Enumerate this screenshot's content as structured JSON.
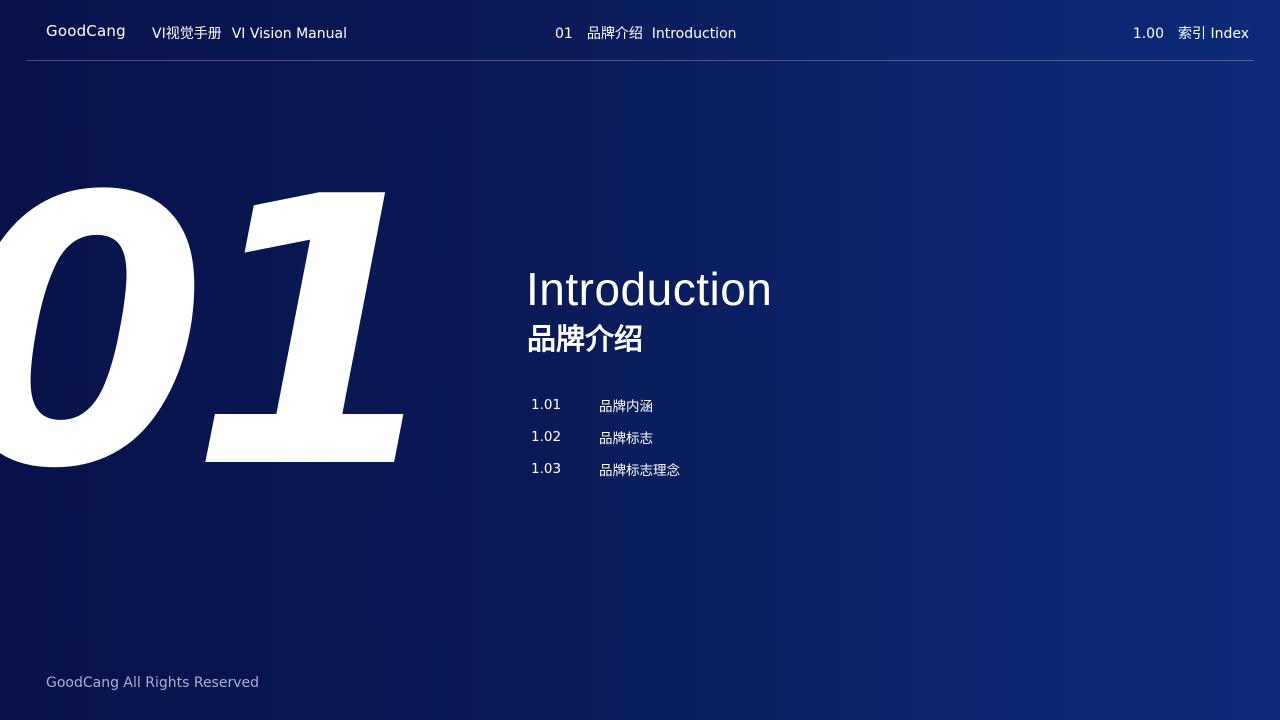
{
  "header": {
    "brand": "GoodCang",
    "manual_zh": "VI视觉手册",
    "manual_en": "VI Vision Manual",
    "section_number": "01",
    "section_zh": "品牌介绍",
    "section_en": "Introduction",
    "index_number": "1.00",
    "index_zh": "索引",
    "index_en": "Index"
  },
  "hero": {
    "number": "01",
    "title_en": "Introduction",
    "title_zh": "品牌介绍"
  },
  "toc": {
    "items": [
      {
        "number": "1.01",
        "label": "品牌内涵"
      },
      {
        "number": "1.02",
        "label": "品牌标志"
      },
      {
        "number": "1.03",
        "label": "品牌标志理念"
      }
    ]
  },
  "footer": {
    "copyright": "GoodCang All Rights Reserved"
  }
}
